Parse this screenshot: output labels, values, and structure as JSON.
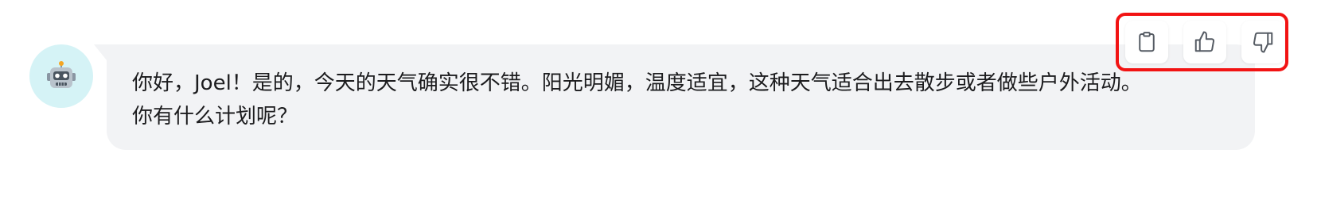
{
  "message": {
    "sender": "assistant",
    "text_line1": "你好，Joel！是的，今天的天气确实很不错。阳光明媚，温度适宜，这种天气适合出去散步或者做些户外活动。",
    "text_line2": "你有什么计划呢？"
  },
  "actions": [
    {
      "name": "copy",
      "icon": "clipboard-icon"
    },
    {
      "name": "like",
      "icon": "thumbs-up-icon"
    },
    {
      "name": "dislike",
      "icon": "thumbs-down-icon"
    }
  ],
  "colors": {
    "avatar_bg": "#d5f3f6",
    "bubble_bg": "#f2f3f5",
    "highlight_border": "#f21313"
  }
}
